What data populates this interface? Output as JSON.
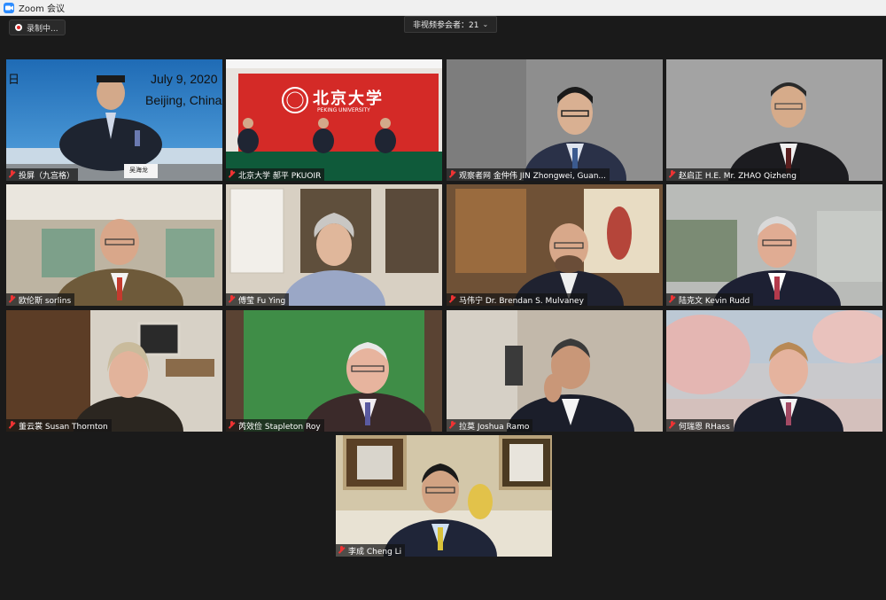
{
  "window": {
    "title": "Zoom 会议"
  },
  "toolbar": {
    "record_label": "录制中...",
    "nonvideo_label": "非视频参会者：21",
    "nonvideo_chevron": "⌄"
  },
  "tiles": [
    {
      "name": "投屏（九宫格）",
      "muted": true,
      "bg": "#2f6fae"
    },
    {
      "name": "北京大学 郝平 PKUOIR",
      "muted": true,
      "bg": "#d42a27"
    },
    {
      "name": "观察者网 金仲伟 JIN Zhongwei, Guan...",
      "muted": true,
      "bg": "#8d8d8d"
    },
    {
      "name": "赵启正 H.E. Mr. ZHAO Qizheng",
      "muted": true,
      "bg": "#9a9a9a"
    },
    {
      "name": "欧伦斯 sorlins",
      "muted": true,
      "bg": "#b9b2a3"
    },
    {
      "name": "傅莹 Fu Ying",
      "muted": true,
      "bg": "#c9c0b1"
    },
    {
      "name": "马伟宁 Dr. Brendan S. Mulvaney",
      "muted": true,
      "bg": "#7a5b3e"
    },
    {
      "name": "陆克文 Kevin Rudd",
      "muted": true,
      "bg": "#b7b8b4"
    },
    {
      "name": "董云裳 Susan Thornton",
      "muted": true,
      "bg": "#6b5038"
    },
    {
      "name": "芮效俭 Stapleton Roy",
      "muted": true,
      "bg": "#3f8a43"
    },
    {
      "name": "拉莫 Joshua Ramo",
      "muted": true,
      "bg": "#bfb6a9"
    },
    {
      "name": "何瑞恩 RHass",
      "muted": true,
      "bg": "#c7a69d"
    },
    {
      "name": "李成 Cheng Li",
      "muted": true,
      "bg": "#cfc3a8"
    }
  ],
  "tile_screen": {
    "date": "July 9, 2020",
    "place": "Beijing, China",
    "left_char": "日",
    "nameplate": "吴海龙"
  },
  "tile_pku": {
    "logo_text": "北京大学",
    "logo_sub": "PEKING UNIVERSITY"
  }
}
